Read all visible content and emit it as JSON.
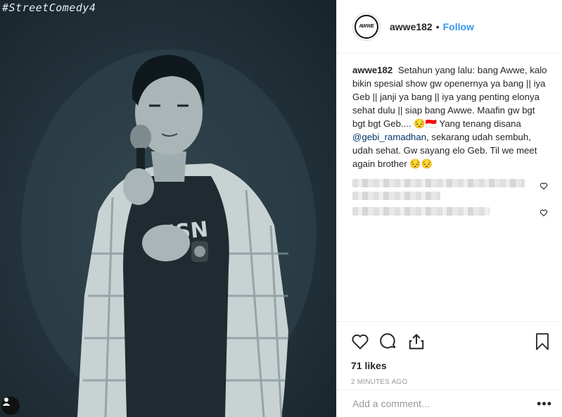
{
  "photo": {
    "overlay_text": "#StreetComedy4",
    "tag_icon": "user-icon"
  },
  "header": {
    "avatar_text": "AWWE",
    "username": "awwe182",
    "separator": "•",
    "follow_label": "Follow"
  },
  "caption": {
    "user": "awwe182",
    "text_before_mention": "Setahun yang lalu: bang Awwe, kalo bikin spesial show gw openernya ya bang || iya Geb || janji ya bang || iya yang penting elonya sehat dulu || siap bang Awwe. Maafin gw bgt bgt bgt Geb.... 😔🇮🇩 Yang tenang disana",
    "mention": "@gebi_ramadhan",
    "text_after_mention": ", sekarang udah sembuh, udah sehat. Gw sayang elo Geb. Til we meet again brother 😔😔"
  },
  "actions": {
    "likes": "71 likes",
    "time": "2 MINUTES AGO"
  },
  "add_comment": {
    "placeholder": "Add a comment...",
    "more": "•••"
  },
  "colors": {
    "link": "#3897f0",
    "mention": "#003569",
    "muted": "#999999",
    "photo_bg": "#25353d"
  }
}
